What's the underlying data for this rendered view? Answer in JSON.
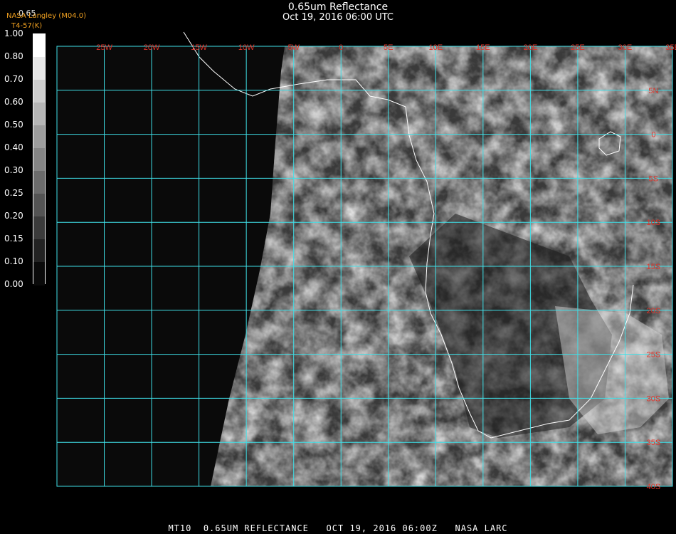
{
  "header": {
    "title": "0.65um Reflectance",
    "datetime": "Oct 19, 2016 06:00 UTC"
  },
  "credit": {
    "value_top": "0.65",
    "org": "NASA Langley (M04.0)",
    "var": "T4-57(K)"
  },
  "scale": {
    "ticks": [
      "1.00",
      "0.80",
      "0.70",
      "0.60",
      "0.50",
      "0.40",
      "0.30",
      "0.25",
      "0.20",
      "0.15",
      "0.10",
      "0.00"
    ]
  },
  "map": {
    "lon_labels": [
      "25W",
      "20W",
      "15W",
      "10W",
      "5W",
      "0",
      "5E",
      "10E",
      "15E",
      "20E",
      "25E",
      "30E",
      "35E"
    ],
    "lat_labels": [
      "5N",
      "0",
      "5S",
      "10S",
      "15S",
      "20S",
      "25S",
      "30S",
      "35S",
      "40S"
    ],
    "grid_color": "#3fe0e8",
    "label_color": "#e0342a",
    "extent": {
      "lon": [
        -30,
        35
      ],
      "lat": [
        10,
        -40
      ]
    }
  },
  "footer": {
    "text": "MT10  0.65UM REFLECTANCE   OCT 19, 2016 06:00Z   NASA LARC"
  }
}
